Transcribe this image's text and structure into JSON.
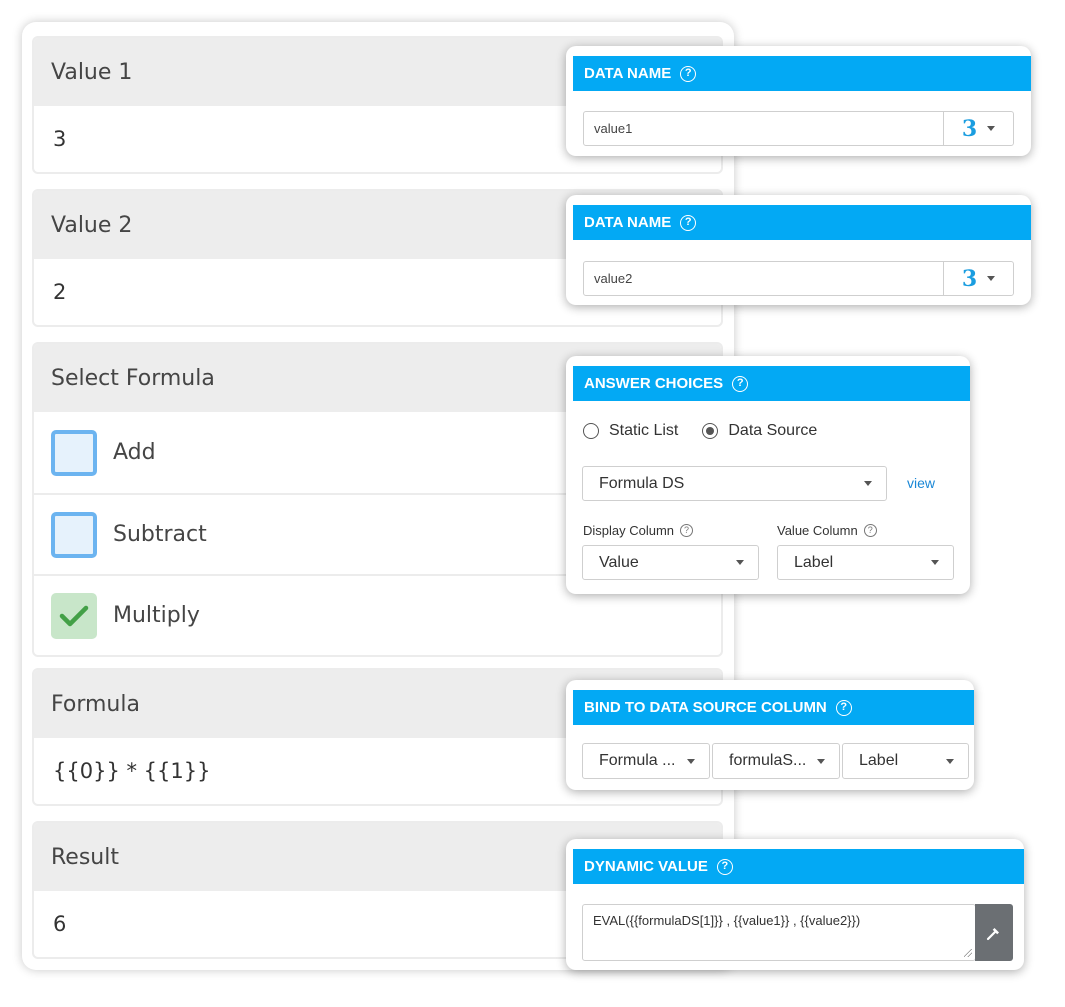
{
  "form": {
    "value1": {
      "label": "Value 1",
      "value": "3"
    },
    "value2": {
      "label": "Value 2",
      "value": "2"
    },
    "select_formula": {
      "label": "Select Formula",
      "options": [
        {
          "label": "Add",
          "checked": false
        },
        {
          "label": "Subtract",
          "checked": false
        },
        {
          "label": "Multiply",
          "checked": true
        }
      ]
    },
    "formula": {
      "label": "Formula",
      "value": "{{0}} * {{1}}"
    },
    "result": {
      "label": "Result",
      "value": "6"
    }
  },
  "popups": {
    "data_name_1": {
      "title": "DATA NAME",
      "help": "?",
      "input_value": "value1",
      "badge": "3"
    },
    "data_name_2": {
      "title": "DATA NAME",
      "help": "?",
      "input_value": "value2",
      "badge": "3"
    },
    "answer_choices": {
      "title": "ANSWER CHOICES",
      "help": "?",
      "radio_static": "Static List",
      "radio_datasource": "Data Source",
      "selected_radio": "Data Source",
      "datasource_value": "Formula DS",
      "view_link": "view",
      "display_column_label": "Display Column",
      "display_column_value": "Value",
      "value_column_label": "Value Column",
      "value_column_value": "Label"
    },
    "bind_column": {
      "title": "BIND TO DATA SOURCE COLUMN",
      "help": "?",
      "select1": "Formula ...",
      "select2": "formulaS...",
      "select3": "Label"
    },
    "dynamic_value": {
      "title": "DYNAMIC VALUE",
      "help": "?",
      "expression": "EVAL({{formulaDS[1]}} , {{value1}} , {{value2}})"
    }
  },
  "colors": {
    "accent": "#03a9f4",
    "checkbox_unchecked_border": "#6cb4f0",
    "checkbox_checked_bg": "#c8e6c9",
    "checkmark": "#43a047"
  },
  "icons": {
    "checkmark": "check-icon",
    "help": "help-circle-icon",
    "dropdown": "chevron-down-icon",
    "wand": "magic-wand-icon"
  }
}
